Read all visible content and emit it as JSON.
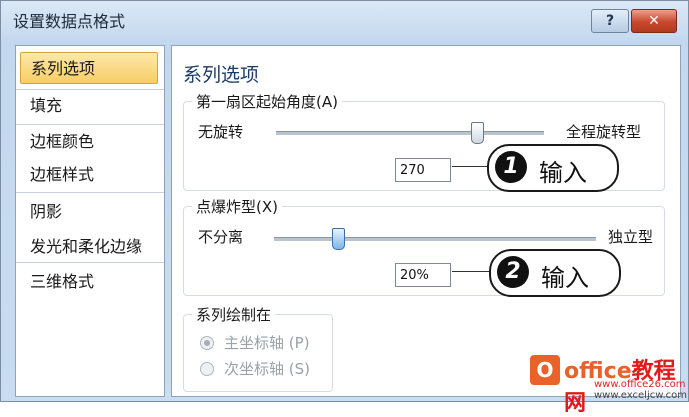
{
  "window": {
    "title": "设置数据点格式",
    "help_label": "?",
    "close_label": "✕"
  },
  "sidebar": {
    "items": [
      {
        "label": "系列选项",
        "active": true
      },
      {
        "label": "填充"
      },
      {
        "label": "边框颜色"
      },
      {
        "label": "边框样式"
      },
      {
        "label": "阴影"
      },
      {
        "label": "发光和柔化边缘"
      },
      {
        "label": "三维格式"
      }
    ]
  },
  "panel": {
    "title": "系列选项",
    "first_slice_angle": {
      "label": "第一扇区起始角度",
      "accel": "(A)",
      "left_label": "无旋转",
      "right_label": "全程旋转型",
      "value": "270",
      "slider_fraction": 0.75
    },
    "point_explosion": {
      "label": "点爆炸型",
      "accel": "(X)",
      "left_label": "不分离",
      "right_label": "独立型",
      "value": "20%",
      "slider_fraction": 0.2
    },
    "plot_series_on": {
      "label": "系列绘制在",
      "options": [
        {
          "label": "主坐标轴",
          "accel": "(P)",
          "checked": true
        },
        {
          "label": "次坐标轴",
          "accel": "(S)",
          "checked": false
        }
      ]
    }
  },
  "callouts": [
    {
      "number": "1",
      "text": "输入"
    },
    {
      "number": "2",
      "text": "输入"
    }
  ],
  "watermark": {
    "logo_letter": "O",
    "brand_a": "office",
    "brand_b": "教程网",
    "url1": "www.office26.com",
    "url2": "www.exceljcw.com"
  }
}
